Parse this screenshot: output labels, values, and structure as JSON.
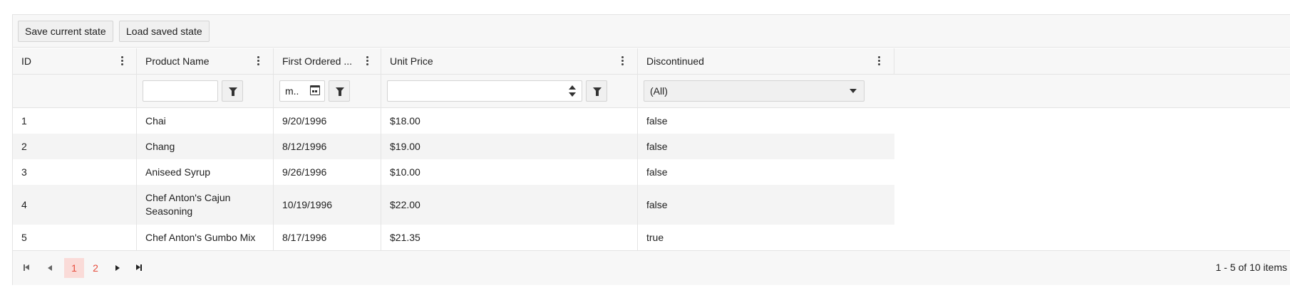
{
  "toolbar": {
    "save_label": "Save current state",
    "load_label": "Load saved state"
  },
  "columns": [
    {
      "title": "ID"
    },
    {
      "title": "Product Name"
    },
    {
      "title": "First Ordered ..."
    },
    {
      "title": "Unit Price"
    },
    {
      "title": "Discontinued"
    }
  ],
  "filters": {
    "product_name_value": "",
    "date_value": "m..",
    "unit_price_value": "",
    "discontinued_value": "(All)"
  },
  "rows": [
    {
      "id": "1",
      "name": "Chai",
      "date": "9/20/1996",
      "price": "$18.00",
      "discontinued": "false"
    },
    {
      "id": "2",
      "name": "Chang",
      "date": "8/12/1996",
      "price": "$19.00",
      "discontinued": "false"
    },
    {
      "id": "3",
      "name": "Aniseed Syrup",
      "date": "9/26/1996",
      "price": "$10.00",
      "discontinued": "false"
    },
    {
      "id": "4",
      "name": "Chef Anton's Cajun Seasoning",
      "date": "10/19/1996",
      "price": "$22.00",
      "discontinued": "false"
    },
    {
      "id": "5",
      "name": "Chef Anton's Gumbo Mix",
      "date": "8/17/1996",
      "price": "$21.35",
      "discontinued": "true"
    }
  ],
  "pager": {
    "pages": [
      "1",
      "2"
    ],
    "current_page": "1",
    "info": "1 - 5 of 10 items"
  },
  "colors": {
    "accent": "#e74c3c",
    "selected_page_bg": "#fadbd8"
  },
  "icons": [
    "kebab-menu-icon",
    "filter-icon",
    "calendar-icon",
    "spinner-arrows-icon",
    "dropdown-arrow-icon",
    "first-page-icon",
    "previous-page-icon",
    "next-page-icon",
    "last-page-icon"
  ]
}
